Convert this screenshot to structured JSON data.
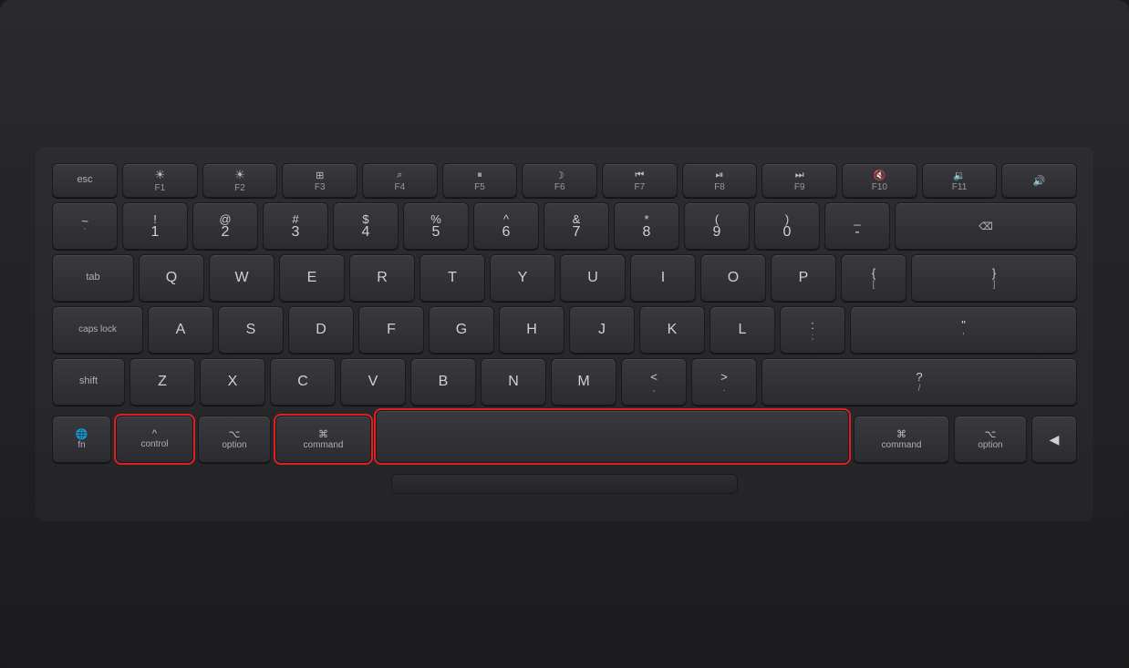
{
  "keyboard": {
    "background": "#252528",
    "rows": {
      "fn_row": {
        "keys": [
          {
            "label": "esc",
            "type": "label"
          },
          {
            "icon": "☀",
            "sub": "F1",
            "type": "icon"
          },
          {
            "icon": "☀",
            "sub": "F2",
            "type": "icon"
          },
          {
            "icon": "⊞",
            "sub": "F3",
            "type": "icon"
          },
          {
            "icon": "⌕",
            "sub": "F4",
            "type": "icon"
          },
          {
            "icon": "🎤",
            "sub": "F5",
            "type": "icon"
          },
          {
            "icon": "☽",
            "sub": "F6",
            "type": "icon"
          },
          {
            "icon": "⏮",
            "sub": "F7",
            "type": "icon"
          },
          {
            "icon": "⏯",
            "sub": "F8",
            "type": "icon"
          },
          {
            "icon": "⏭",
            "sub": "F9",
            "type": "icon"
          },
          {
            "icon": "🔇",
            "sub": "F10",
            "type": "icon"
          },
          {
            "icon": "🔉",
            "sub": "F11",
            "type": "icon"
          }
        ]
      },
      "number_row": {
        "keys": [
          {
            "top": "~",
            "main": "`",
            "type": "dual"
          },
          {
            "top": "!",
            "main": "1",
            "type": "dual"
          },
          {
            "top": "@",
            "main": "2",
            "type": "dual"
          },
          {
            "top": "#",
            "main": "3",
            "type": "dual"
          },
          {
            "top": "$",
            "main": "4",
            "type": "dual"
          },
          {
            "top": "%",
            "main": "5",
            "type": "dual"
          },
          {
            "top": "^",
            "main": "6",
            "type": "dual"
          },
          {
            "top": "&",
            "main": "7",
            "type": "dual"
          },
          {
            "top": "*",
            "main": "8",
            "type": "dual"
          },
          {
            "top": "(",
            "main": "9",
            "type": "dual"
          },
          {
            "top": ")",
            "main": "0",
            "type": "dual"
          },
          {
            "top": "_",
            "main": "-",
            "type": "dual"
          }
        ]
      },
      "qwerty_row": {
        "keys": [
          "Q",
          "W",
          "E",
          "R",
          "T",
          "Y",
          "U",
          "I",
          "O",
          "P"
        ]
      },
      "asdf_row": {
        "keys": [
          "A",
          "S",
          "D",
          "F",
          "G",
          "H",
          "J",
          "K",
          "L"
        ]
      },
      "zxcv_row": {
        "keys": [
          "Z",
          "X",
          "C",
          "V",
          "B",
          "N",
          "M"
        ]
      },
      "bottom_row": {
        "fn": "fn",
        "fn_icon": "🌐",
        "ctrl_icon": "^",
        "ctrl_label": "control",
        "opt_symbol": "⌥",
        "opt_label": "option",
        "cmd_symbol": "⌘",
        "cmd_label": "command",
        "cmd_symbol_r": "⌘",
        "cmd_label_r": "command",
        "opt_symbol_r": "⌥",
        "opt_label_r": "option",
        "arrow": "◀"
      }
    },
    "highlights": {
      "ctrl": true,
      "cmd_left": true,
      "spacebar": true
    }
  }
}
